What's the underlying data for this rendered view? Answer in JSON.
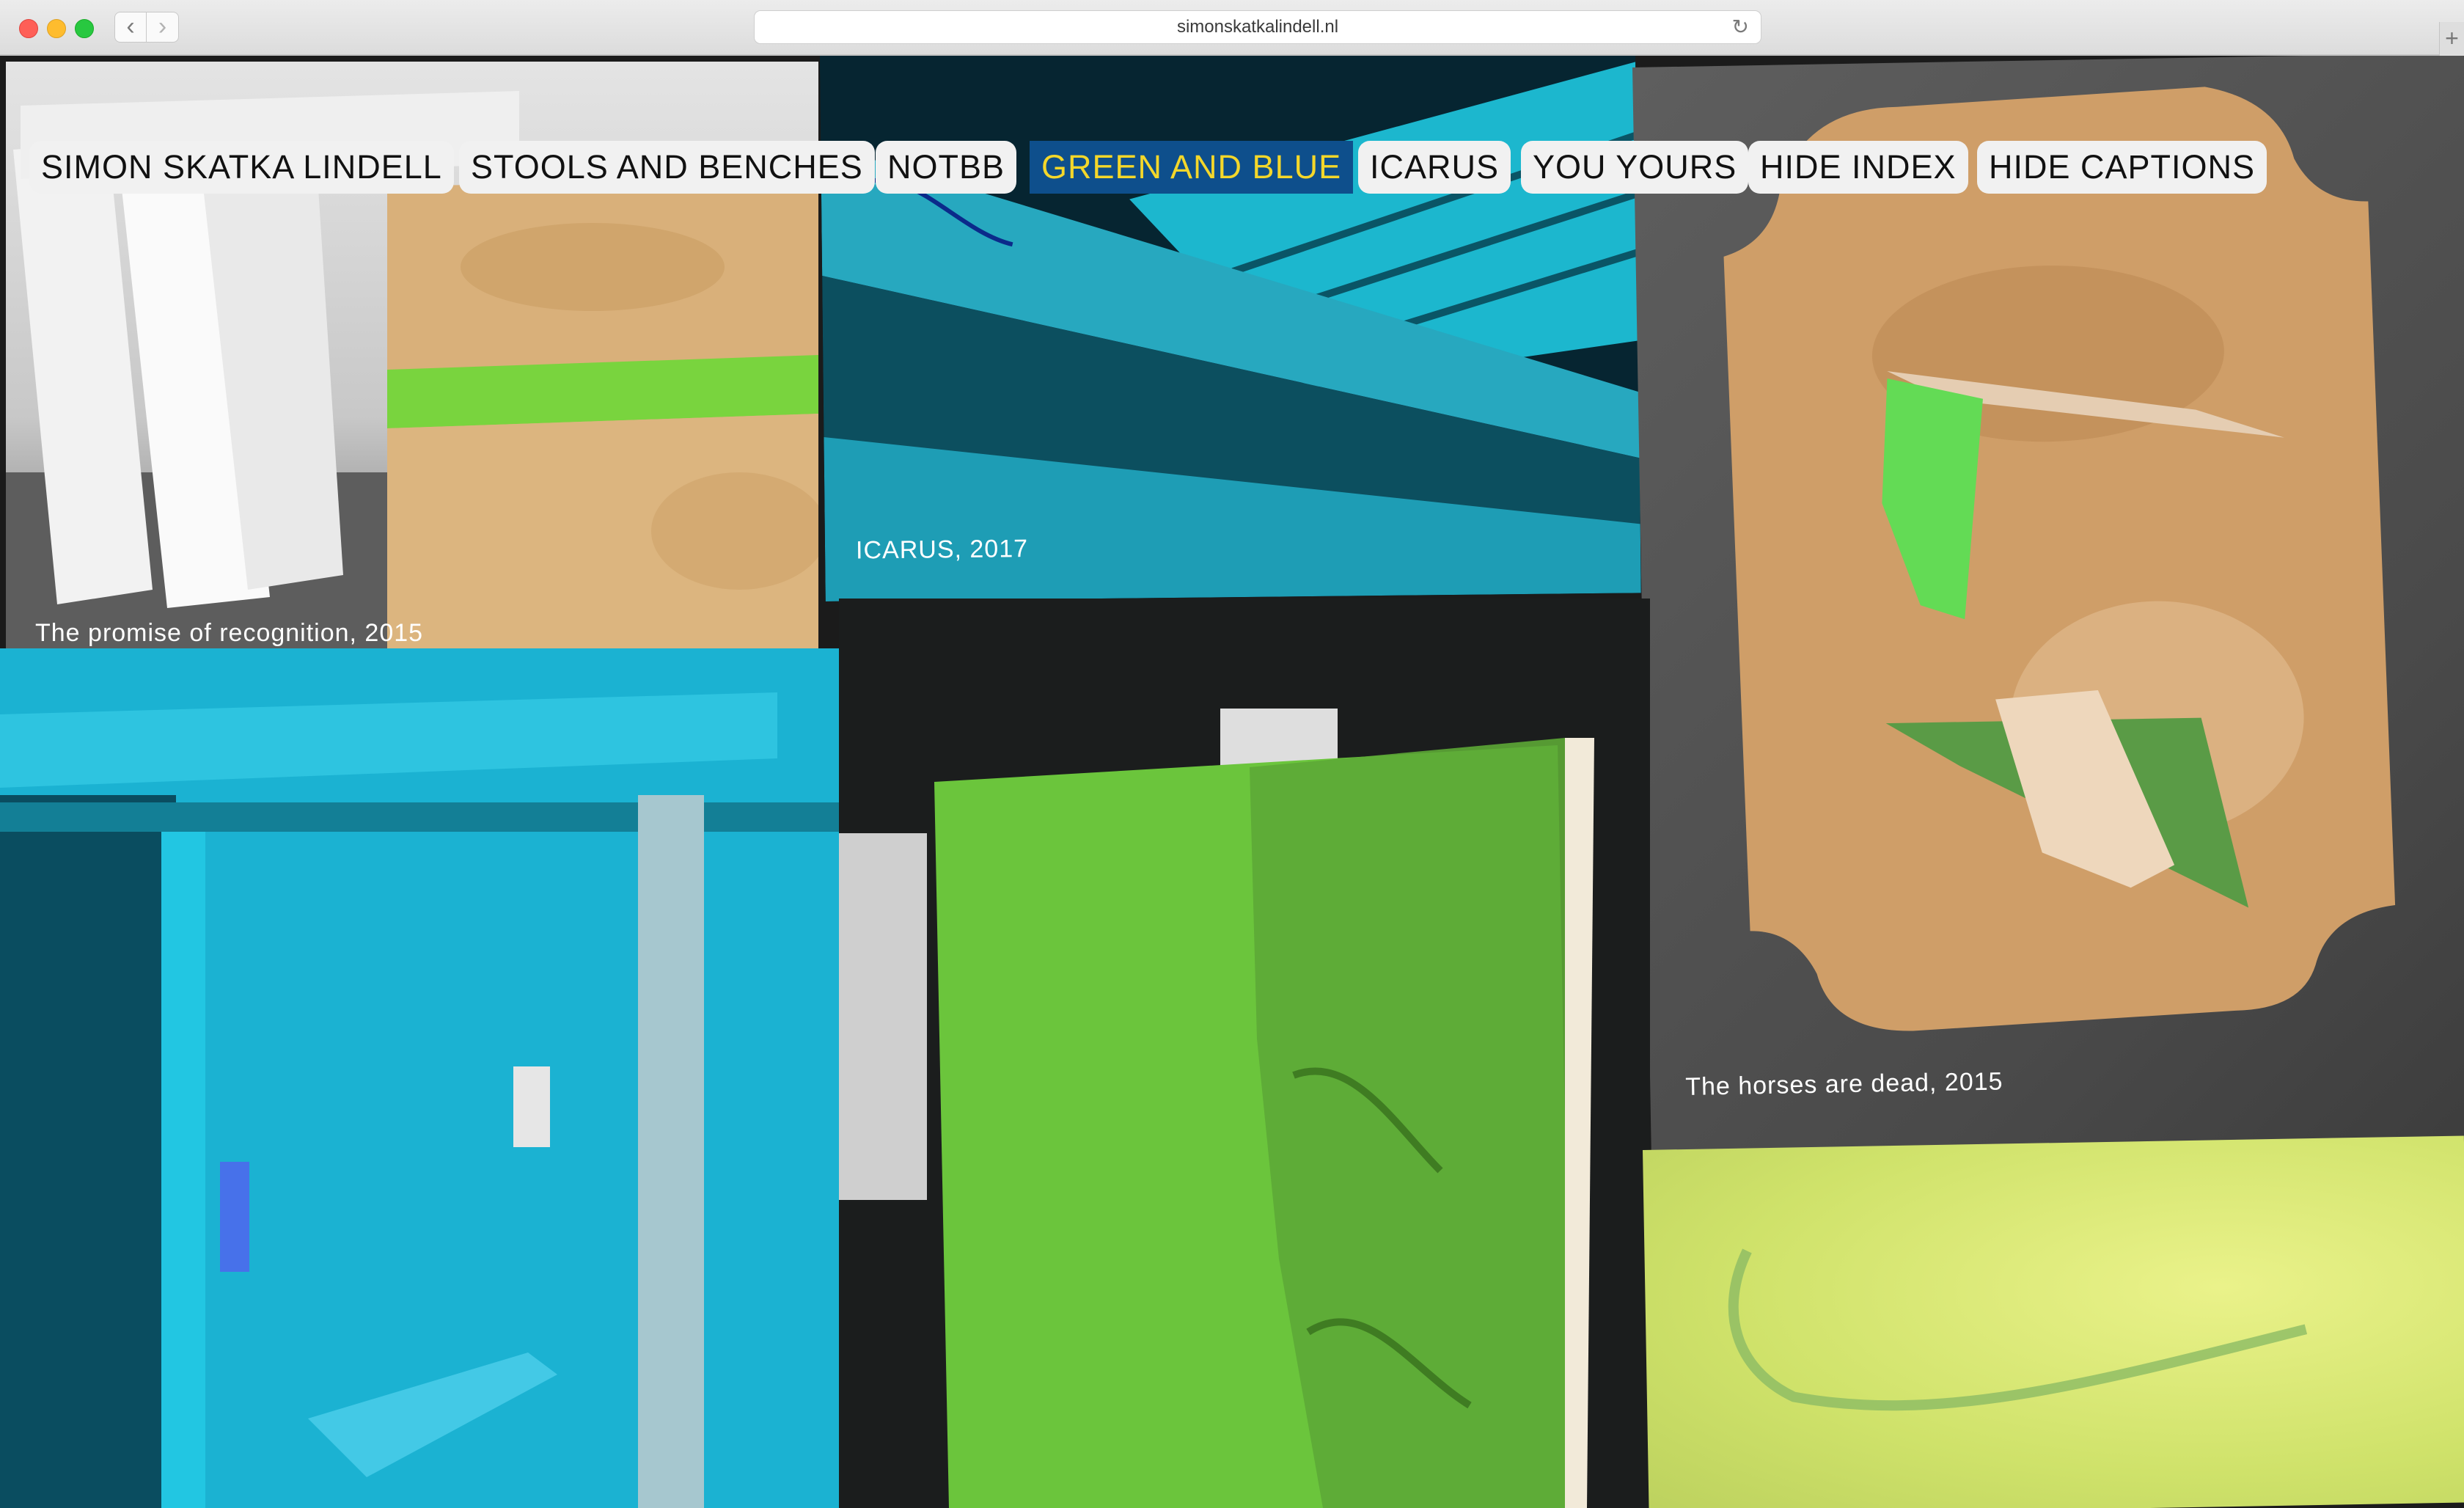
{
  "browser": {
    "url": "simonskatkalindell.nl",
    "back_glyph": "‹",
    "forward_glyph": "›",
    "reload_glyph": "↻",
    "new_tab_glyph": "+"
  },
  "nav": {
    "items": [
      {
        "label": "SIMON SKATKA LINDELL",
        "active": false
      },
      {
        "label": "STOOLS AND BENCHES",
        "active": false
      },
      {
        "label": "NOTBB",
        "active": false
      },
      {
        "label": "GREEN AND BLUE",
        "active": true
      },
      {
        "label": "ICARUS",
        "active": false
      },
      {
        "label": "YOU YOURS",
        "active": false
      },
      {
        "label": "HIDE INDEX",
        "active": false
      },
      {
        "label": "HIDE CAPTIONS",
        "active": false
      }
    ],
    "active_bg": "#0e4f8c",
    "active_text": "#f4d72a"
  },
  "captions": {
    "tile1": "The promise of recognition, 2015",
    "tile2": "ICARUS, 2017",
    "tile3": "The horses are dead, 2015"
  }
}
